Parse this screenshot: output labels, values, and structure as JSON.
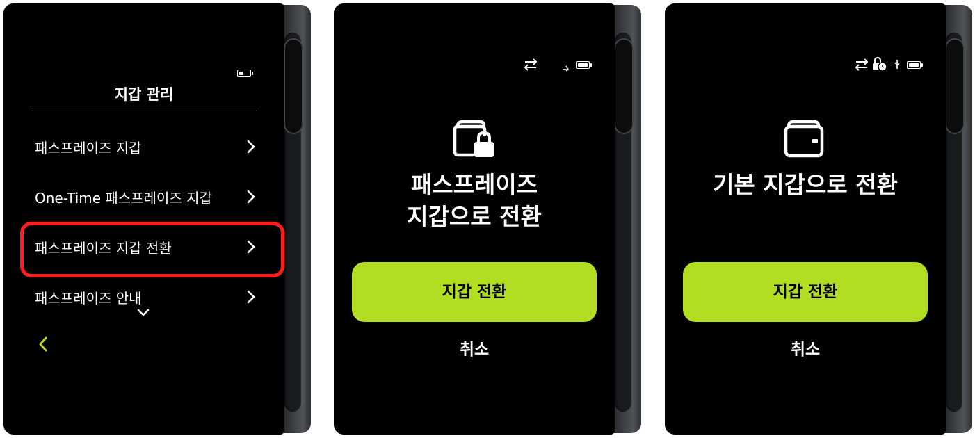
{
  "screens": [
    {
      "title": "지갑 관리",
      "menu": [
        "패스프레이즈 지갑",
        "One-Time 패스프레이즈 지갑",
        "패스프레이즈 지갑 전환",
        "패스프레이즈 안내"
      ],
      "highlighted_item": "패스프레이즈 지갑 전환",
      "highlight_color": "#ff1e1e",
      "accent_color": "#b1dd22",
      "status_icons": [
        "battery-icon"
      ]
    },
    {
      "title_line1": "패스프레이즈",
      "title_line2": "지갑으로 전환",
      "primary_button": "지갑 전환",
      "cancel_button": "취소",
      "icon": "wallet-lock-icon",
      "status_icons": [
        "sync-arrows-icon",
        "usb-icon",
        "battery-icon"
      ]
    },
    {
      "title_line1": "기본 지갑으로 전환",
      "primary_button": "지갑 전환",
      "cancel_button": "취소",
      "icon": "wallet-icon",
      "status_icons": [
        "sync-arrows-icon",
        "lock-clock-icon",
        "usb-icon",
        "battery-icon"
      ]
    }
  ],
  "colors": {
    "button_green": "#b1dd22",
    "screen_bg": "#000000",
    "highlight_red": "#ff1e1e"
  }
}
